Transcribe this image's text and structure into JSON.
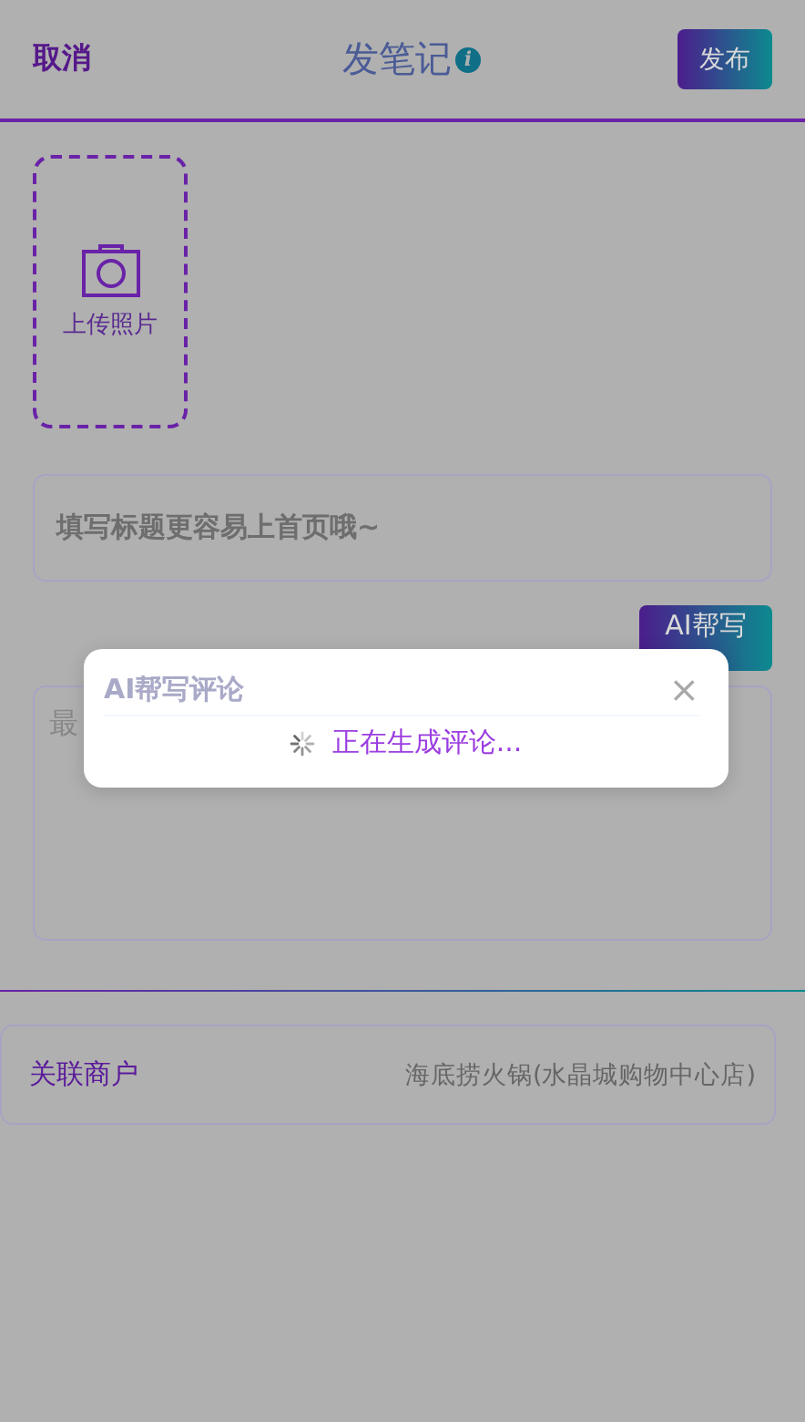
{
  "header": {
    "cancel": "取消",
    "title": "发笔记",
    "info": "i",
    "publish": "发布"
  },
  "upload": {
    "label": "上传照片"
  },
  "title_field": {
    "placeholder": "填写标题更容易上首页哦~"
  },
  "ai_button": "AI帮写",
  "review_field": {
    "placeholder": "最"
  },
  "merchant": {
    "label": "关联商户",
    "value": "海底捞火锅(水晶城购物中心店)"
  },
  "dialog": {
    "title": "AI帮写评论",
    "close": "×",
    "loading": "正在生成评论..."
  }
}
